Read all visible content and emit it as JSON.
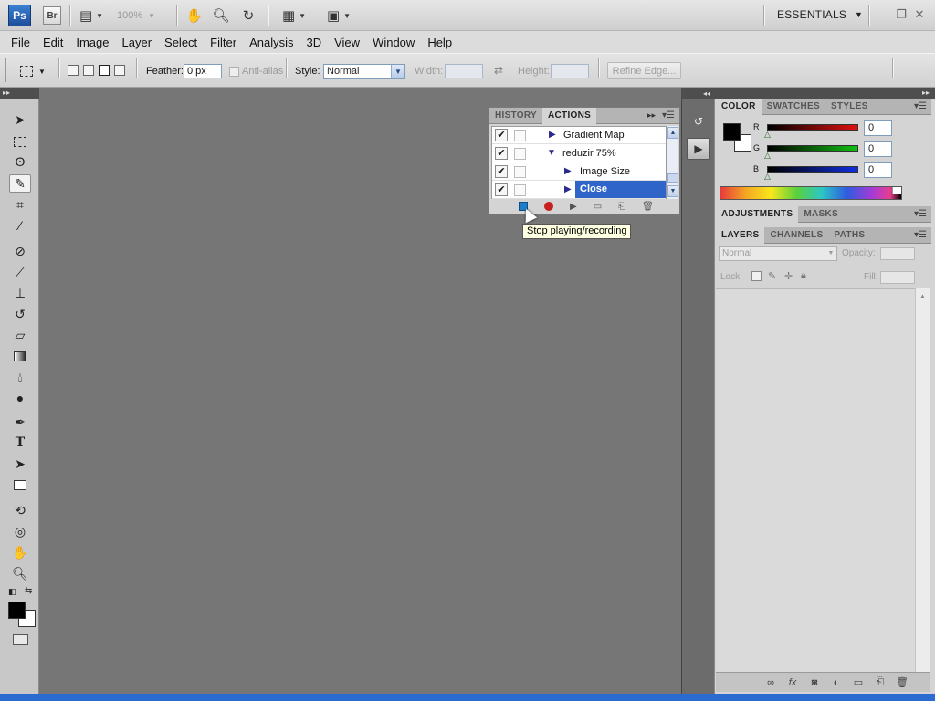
{
  "appbar": {
    "logo": "Ps",
    "bridge": "Br",
    "zoom": "100%",
    "workspace": "ESSENTIALS"
  },
  "menu": [
    "File",
    "Edit",
    "Image",
    "Layer",
    "Select",
    "Filter",
    "Analysis",
    "3D",
    "View",
    "Window",
    "Help"
  ],
  "options": {
    "feather_label": "Feather:",
    "feather_value": "0 px",
    "antialias_label": "Anti-alias",
    "style_label": "Style:",
    "style_value": "Normal",
    "width_label": "Width:",
    "height_label": "Height:",
    "refine_edge": "Refine Edge..."
  },
  "actions_panel": {
    "tabs": [
      "HISTORY",
      "ACTIONS"
    ],
    "active_tab": "ACTIONS",
    "rows": [
      {
        "label": "Gradient Map",
        "checked": true,
        "expanded": false,
        "indent": 1
      },
      {
        "label": "reduzir 75%",
        "checked": true,
        "expanded": true,
        "indent": 0
      },
      {
        "label": "Image Size",
        "checked": true,
        "expanded": false,
        "indent": 2
      },
      {
        "label": "Close",
        "checked": true,
        "expanded": false,
        "indent": 2,
        "selected": true
      }
    ]
  },
  "tooltip": "Stop playing/recording",
  "color_panel": {
    "tabs": [
      "COLOR",
      "SWATCHES",
      "STYLES"
    ],
    "channels": [
      {
        "label": "R",
        "value": "0",
        "color": "#d01010"
      },
      {
        "label": "G",
        "value": "0",
        "color": "#10b010"
      },
      {
        "label": "B",
        "value": "0",
        "color": "#1020d0"
      }
    ]
  },
  "adjust_tabs": [
    "ADJUSTMENTS",
    "MASKS"
  ],
  "layers_panel": {
    "tabs": [
      "LAYERS",
      "CHANNELS",
      "PATHS"
    ],
    "blend_mode": "Normal",
    "opacity_label": "Opacity:",
    "lock_label": "Lock:",
    "fill_label": "Fill:"
  },
  "colors": {
    "canvas": "#767676",
    "selection": "#2f64c8",
    "taskbar": "#2b6bd0"
  }
}
